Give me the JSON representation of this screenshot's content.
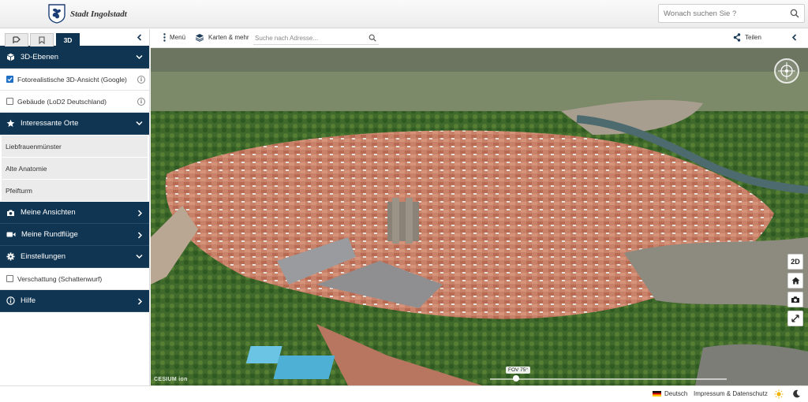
{
  "header": {
    "brand": "Stadt Ingolstadt",
    "search_placeholder": "Wonach suchen Sie ?"
  },
  "panel": {
    "tabs": [
      {
        "icon": "route-icon",
        "label": ""
      },
      {
        "icon": "bookmark-icon",
        "label": ""
      },
      {
        "icon": "",
        "label": "3D"
      }
    ],
    "sections": {
      "layers": {
        "label": "3D-Ebenen",
        "icon": "cube-icon"
      },
      "places": {
        "label": "Interessante Orte",
        "icon": "star-icon"
      },
      "views": {
        "label": "Meine Ansichten",
        "icon": "camera-icon"
      },
      "flights": {
        "label": "Meine Rundflüge",
        "icon": "video-icon"
      },
      "settings": {
        "label": "Einstellungen",
        "icon": "gear-icon"
      },
      "help": {
        "label": "Hilfe",
        "icon": "info-icon"
      }
    },
    "layers": [
      {
        "label": "Fotorealistische 3D-Ansicht (Google)",
        "checked": true
      },
      {
        "label": "Gebäude (LoD2 Deutschland)",
        "checked": false
      }
    ],
    "places": [
      "Liebfrauenmünster",
      "Alte Anatomie",
      "Pfeifturm"
    ],
    "settings_option": {
      "label": "Verschattung (Schattenwurf)",
      "checked": false
    }
  },
  "toolbar": {
    "menu_label": "Menü",
    "maps_label": "Karten & mehr",
    "address_placeholder": "Suche nach Adresse...",
    "share_label": "Teilen"
  },
  "map": {
    "mode_button": "2D",
    "fov_label": "FOV 75°",
    "credit": "CESIUM ion"
  },
  "footer": {
    "language": "Deutsch",
    "imprint": "Impressum & Datenschutz"
  },
  "colors": {
    "panel_header": "#0f3552",
    "checkbox": "#1f6fc5"
  }
}
